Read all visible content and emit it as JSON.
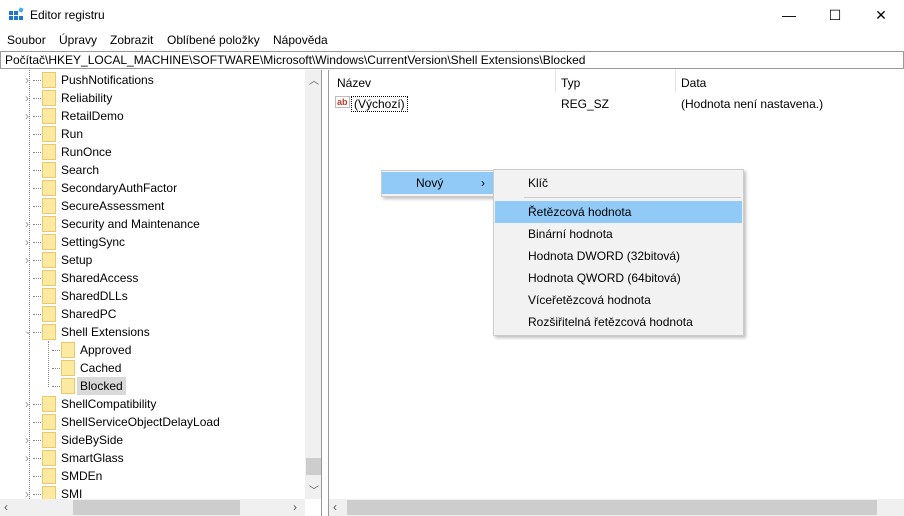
{
  "window": {
    "title": "Editor registru",
    "minimize": "—",
    "maximize": "☐",
    "close": "✕"
  },
  "menu": [
    "Soubor",
    "Úpravy",
    "Zobrazit",
    "Oblíbené položky",
    "Nápověda"
  ],
  "address": "Počítač\\HKEY_LOCAL_MACHINE\\SOFTWARE\\Microsoft\\Windows\\CurrentVersion\\Shell Extensions\\Blocked",
  "tree": [
    {
      "label": "PushNotifications",
      "level": 1,
      "expander": "collapsed"
    },
    {
      "label": "Reliability",
      "level": 1,
      "expander": "collapsed"
    },
    {
      "label": "RetailDemo",
      "level": 1,
      "expander": "collapsed"
    },
    {
      "label": "Run",
      "level": 1,
      "expander": "none"
    },
    {
      "label": "RunOnce",
      "level": 1,
      "expander": "none"
    },
    {
      "label": "Search",
      "level": 1,
      "expander": "none"
    },
    {
      "label": "SecondaryAuthFactor",
      "level": 1,
      "expander": "none"
    },
    {
      "label": "SecureAssessment",
      "level": 1,
      "expander": "none"
    },
    {
      "label": "Security and Maintenance",
      "level": 1,
      "expander": "collapsed"
    },
    {
      "label": "SettingSync",
      "level": 1,
      "expander": "collapsed"
    },
    {
      "label": "Setup",
      "level": 1,
      "expander": "collapsed"
    },
    {
      "label": "SharedAccess",
      "level": 1,
      "expander": "none"
    },
    {
      "label": "SharedDLLs",
      "level": 1,
      "expander": "none"
    },
    {
      "label": "SharedPC",
      "level": 1,
      "expander": "none"
    },
    {
      "label": "Shell Extensions",
      "level": 1,
      "expander": "expanded"
    },
    {
      "label": "Approved",
      "level": 2,
      "expander": "none"
    },
    {
      "label": "Cached",
      "level": 2,
      "expander": "none"
    },
    {
      "label": "Blocked",
      "level": 2,
      "expander": "none",
      "selected": true
    },
    {
      "label": "ShellCompatibility",
      "level": 1,
      "expander": "collapsed"
    },
    {
      "label": "ShellServiceObjectDelayLoad",
      "level": 1,
      "expander": "none"
    },
    {
      "label": "SideBySide",
      "level": 1,
      "expander": "collapsed"
    },
    {
      "label": "SmartGlass",
      "level": 1,
      "expander": "collapsed"
    },
    {
      "label": "SMDEn",
      "level": 1,
      "expander": "none"
    },
    {
      "label": "SMI",
      "level": 1,
      "expander": "collapsed"
    }
  ],
  "columns": {
    "name": "Název",
    "type": "Typ",
    "data": "Data"
  },
  "values": [
    {
      "icon": "ab",
      "name": "(Výchozí)",
      "type": "REG_SZ",
      "data": "(Hodnota není nastavena.)"
    }
  ],
  "context_menu": {
    "new_label": "Nový",
    "arrow": "›"
  },
  "submenu": {
    "items": [
      "Klíč",
      "Řetězcová hodnota",
      "Binární hodnota",
      "Hodnota DWORD (32bitová)",
      "Hodnota QWORD (64bitová)",
      "Víceřetězcová hodnota",
      "Rozšiřitelná řetězcová hodnota"
    ],
    "highlighted": "Řetězcová hodnota"
  },
  "colors": {
    "highlight": "#91c9f7",
    "selection": "#d9d9d9",
    "folder": "#fde9a0"
  }
}
